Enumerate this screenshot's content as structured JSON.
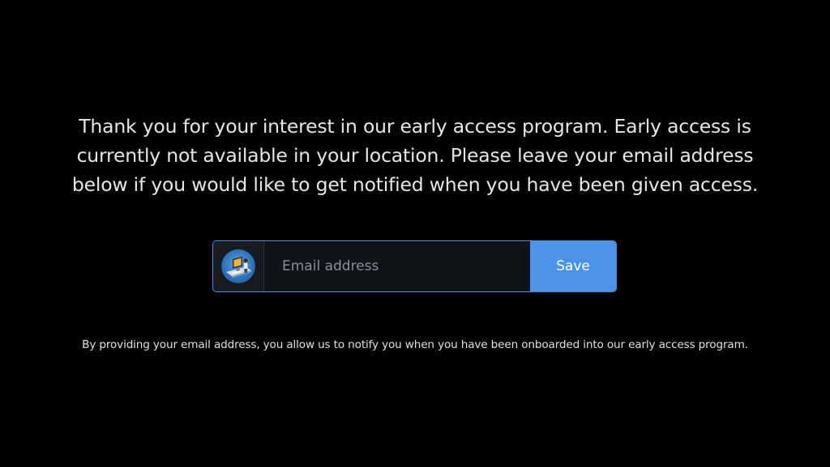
{
  "message": {
    "lines": [
      "Thank you for your interest in our early access program. Early access is",
      "currently not available in your location. Please leave your email address",
      "below if you would like to get notified when you have been given access."
    ]
  },
  "form": {
    "avatar_icon": "computer-user-avatar-icon",
    "email_placeholder": "Email address",
    "email_value": "",
    "save_label": "Save"
  },
  "disclaimer": "By providing your email address, you allow us to notify you when you have been onboarded into our early access program.",
  "colors": {
    "background": "#000000",
    "accent": "#4a93e8",
    "input_border": "#4a8fdc",
    "text": "#e6e6e6"
  }
}
